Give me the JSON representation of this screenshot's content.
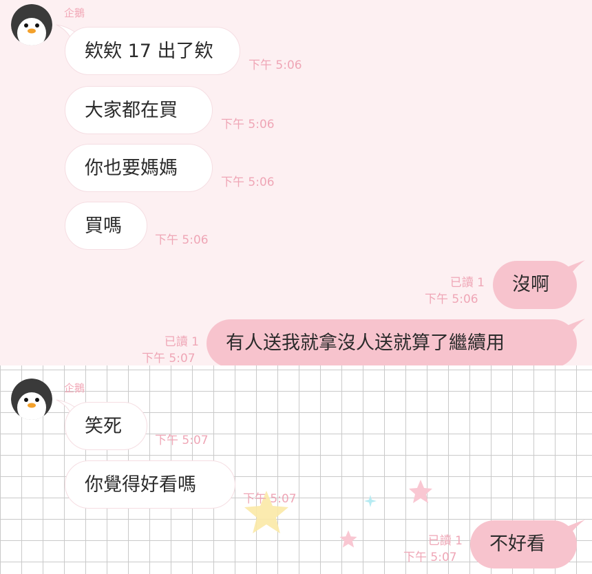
{
  "chat": {
    "contact_name": "企鵝",
    "sections": [
      {
        "sender": "企鵝",
        "incoming": [
          {
            "text": "欸欸 17 出了欸",
            "time": "下午 5:06"
          },
          {
            "text": "大家都在買",
            "time": "下午 5:06"
          },
          {
            "text": "你也要媽媽",
            "time": "下午 5:06"
          },
          {
            "text": "買嗎",
            "time": "下午 5:06"
          }
        ],
        "outgoing": [
          {
            "text": "沒啊",
            "read": "已讀 1",
            "time": "下午 5:06"
          },
          {
            "text": "有人送我就拿沒人送就算了繼續用",
            "read": "已讀 1",
            "time": "下午 5:07"
          }
        ]
      },
      {
        "sender": "企鵝",
        "incoming": [
          {
            "text": "笑死",
            "time": "下午 5:07"
          },
          {
            "text": "你覺得好看嗎",
            "time": "下午 5:07"
          }
        ],
        "outgoing": [
          {
            "text": "不好看",
            "read": "已讀 1",
            "time": "下午 5:07"
          }
        ]
      }
    ]
  },
  "icons": {
    "avatar": "penguin-avatar-icon",
    "decorations": [
      "pink-star-icon",
      "yellow-star-icon",
      "cyan-sparkle-icon"
    ]
  },
  "colors": {
    "top_background": "#fdf0f2",
    "outgoing_bubble": "#f7c3cd",
    "incoming_bubble": "#ffffff",
    "meta_text": "#efa6b6"
  }
}
